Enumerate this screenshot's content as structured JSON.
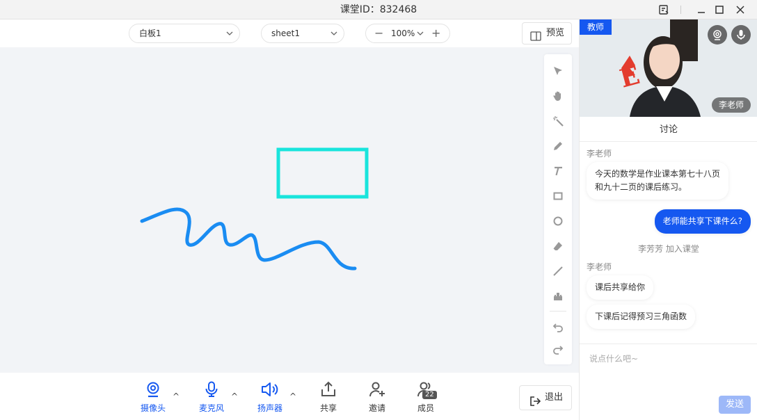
{
  "window": {
    "title": "课堂ID：832468"
  },
  "toolbar": {
    "board_select": "白板1",
    "sheet_select": "sheet1",
    "zoom": "100%",
    "zoom_out": "−",
    "zoom_in": "+",
    "preview_label": "预览"
  },
  "tools": [
    "select-icon",
    "hand-icon",
    "laser-pointer-icon",
    "pen-icon",
    "text-icon",
    "rectangle-icon",
    "circle-icon",
    "eraser-icon",
    "line-icon",
    "stamp-icon",
    "undo-icon",
    "redo-icon"
  ],
  "drawing": {
    "rect_color": "#19e4dc",
    "line_color": "#1a8cf2"
  },
  "media": {
    "camera": "摄像头",
    "mic": "麦克风",
    "speaker": "扬声器",
    "share": "共享",
    "invite": "邀请",
    "members": "成员",
    "members_count": "22",
    "caret": "^",
    "exit": "退出"
  },
  "video": {
    "role_tag": "教师",
    "name": "李老师"
  },
  "chat": {
    "title": "讨论",
    "messages": [
      {
        "sender": "李老师",
        "text_line1": "今天的数学是作业课本第七十八页",
        "text_line2": "和九十二页的课后练习。"
      },
      {
        "text": "老师能共享下课件么?"
      },
      {
        "system": "李芳芳 加入课堂"
      },
      {
        "sender": "李老师",
        "text": "课后共享给你"
      },
      {
        "text": "下课后记得预习三角函数"
      }
    ],
    "input_placeholder": "说点什么吧~",
    "send_label": "发送"
  },
  "colors": {
    "accent": "#1558f0",
    "canvas_bg": "#f2f4f7"
  }
}
